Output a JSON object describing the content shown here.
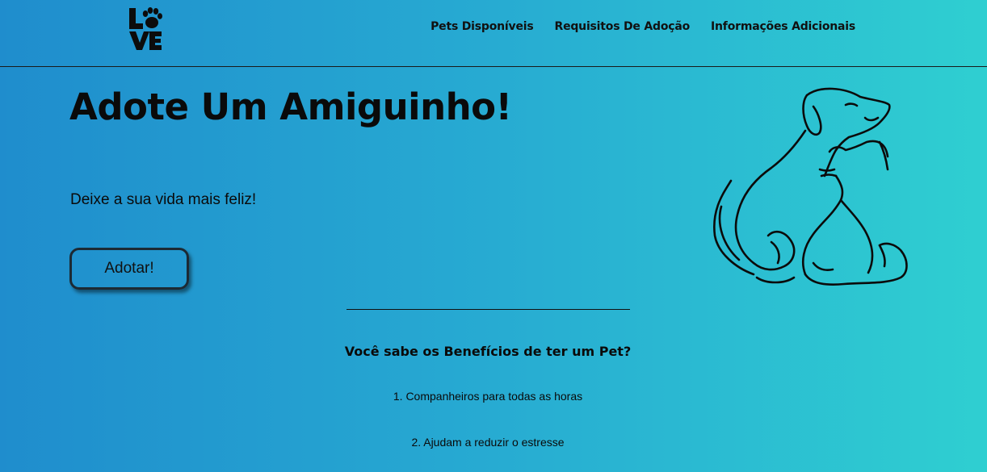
{
  "header": {
    "logo_text": "LOVE",
    "nav": [
      {
        "label": "Pets Disponíveis"
      },
      {
        "label": "Requisitos De Adoção"
      },
      {
        "label": "Informações Adicionais"
      }
    ]
  },
  "hero": {
    "title": "Adote Um Amiguinho!",
    "subtitle": "Deixe a sua vida mais feliz!",
    "button_label": "Adotar!"
  },
  "benefits": {
    "title": "Você sabe os Benefícios de ter um Pet?",
    "items": [
      "1. Companheiros para todas as horas",
      "2. Ajudam a reduzir o estresse"
    ]
  },
  "colors": {
    "gradient_start": "#1f8dcd",
    "gradient_end": "#2fcfd1",
    "text": "#0a0a0a"
  },
  "icons": {
    "logo": "love-paw-logo-icon",
    "illustration": "dog-and-cat-outline-illustration"
  }
}
